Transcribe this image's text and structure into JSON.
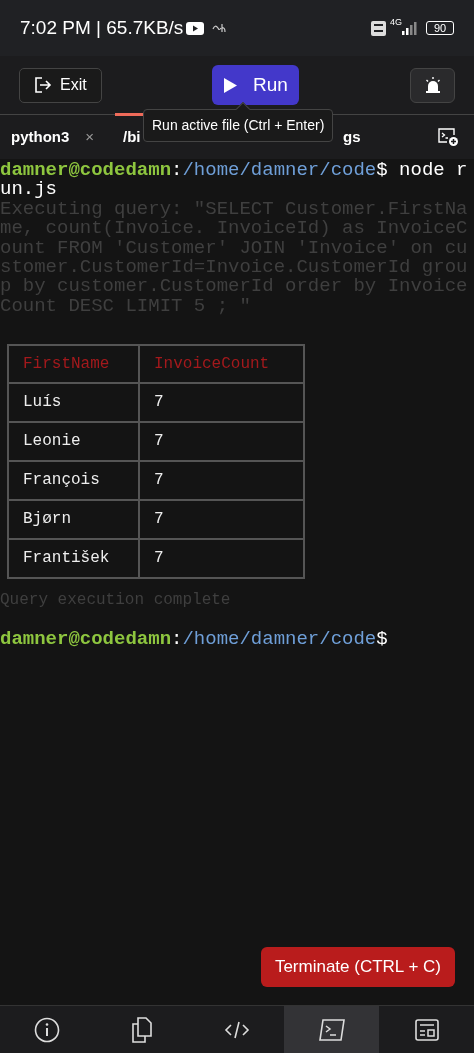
{
  "status_bar": {
    "time": "7:02 PM | 65.7KB/s",
    "network": "4G",
    "battery": "90"
  },
  "toolbar": {
    "exit_label": "Exit",
    "run_label": "Run",
    "tooltip": "Run active file (Ctrl + Enter)"
  },
  "tabs": [
    {
      "label": "python3",
      "close": "×",
      "selected": false
    },
    {
      "label": "/bi",
      "selected": true
    },
    {
      "label": "gs",
      "selected": false
    }
  ],
  "terminal": {
    "prompt": {
      "user": "damner@codedamn",
      "separator": ":",
      "path": "/home/damner/code",
      "sign": "$",
      "command": "node run.js"
    },
    "query_log": "Executing query: \"SELECT Customer.FirstName, count(Invoice. InvoiceId) as InvoiceCount FROM 'Customer' JOIN 'Invoice' on customer.CustomerId=Invoice.CustomerId group by customer.CustomerId order by InvoiceCount DESC LIMIT 5 ; \"",
    "table": {
      "columns": [
        "FirstName",
        "InvoiceCount"
      ],
      "rows": [
        [
          "Luís",
          "7"
        ],
        [
          "Leonie",
          "7"
        ],
        [
          "François",
          "7"
        ],
        [
          "Bjørn",
          "7"
        ],
        [
          "František",
          "7"
        ]
      ]
    },
    "done_message": "Query execution complete",
    "final_prompt": {
      "user": "damner@codedamn",
      "separator": ":",
      "path": "/home/damner/code",
      "sign": "$"
    }
  },
  "terminate_button": "Terminate (CTRL + C)",
  "bottom_nav": [
    {
      "kind": "info",
      "selected": false
    },
    {
      "kind": "files",
      "selected": false
    },
    {
      "kind": "code",
      "selected": false
    },
    {
      "kind": "terminal",
      "selected": true
    },
    {
      "kind": "preview",
      "selected": false
    }
  ]
}
